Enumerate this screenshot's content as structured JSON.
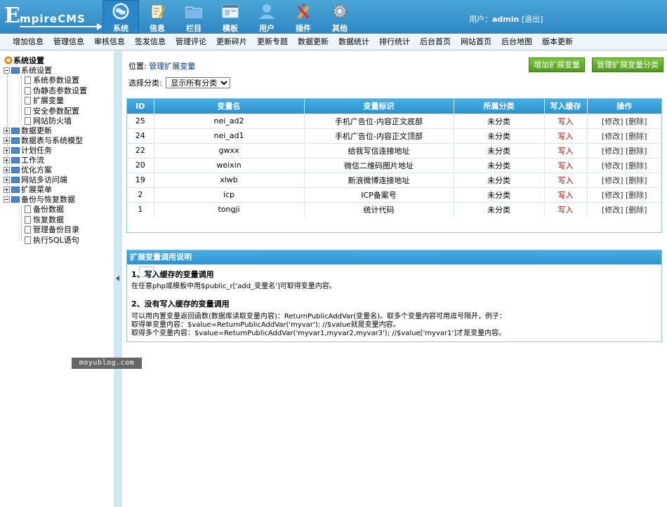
{
  "header": {
    "logo_first": "E",
    "logo_rest": "mpireCMS",
    "nav": [
      {
        "label": "系统",
        "icon": "globe-icon",
        "active": true
      },
      {
        "label": "信息",
        "icon": "edit-document-icon"
      },
      {
        "label": "栏目",
        "icon": "folder-icon"
      },
      {
        "label": "模板",
        "icon": "template-window-icon"
      },
      {
        "label": "用户",
        "icon": "user-icon"
      },
      {
        "label": "插件",
        "icon": "tools-icon"
      },
      {
        "label": "其他",
        "icon": "gear-icon"
      }
    ],
    "user_label": "用户：",
    "username": "admin",
    "logout": "[退出]"
  },
  "submenu": [
    "增加信息",
    "管理信息",
    "审核信息",
    "签发信息",
    "管理评论",
    "更新碎片",
    "更新专题",
    "数据更新",
    "数据统计",
    "排行统计",
    "后台首页",
    "网站首页",
    "后台地图",
    "版本更新"
  ],
  "sidebar": {
    "root": "系统设置",
    "items": [
      {
        "label": "系统设置",
        "type": "folder",
        "expanded": true
      },
      {
        "label": "系统参数设置",
        "type": "doc"
      },
      {
        "label": "伪静态参数设置",
        "type": "doc"
      },
      {
        "label": "扩展变量",
        "type": "doc"
      },
      {
        "label": "安全参数配置",
        "type": "doc"
      },
      {
        "label": "网站防火墙",
        "type": "doc"
      },
      {
        "label": "数据更新",
        "type": "folder"
      },
      {
        "label": "数据表与系统模型",
        "type": "folder"
      },
      {
        "label": "计划任务",
        "type": "folder"
      },
      {
        "label": "工作流",
        "type": "folder"
      },
      {
        "label": "优化方案",
        "type": "folder"
      },
      {
        "label": "网站多访问端",
        "type": "folder"
      },
      {
        "label": "扩展菜单",
        "type": "folder"
      },
      {
        "label": "备份与恢复数据",
        "type": "folder",
        "expanded": true
      },
      {
        "label": "备份数据",
        "type": "doc"
      },
      {
        "label": "恢复数据",
        "type": "doc"
      },
      {
        "label": "管理备份目录",
        "type": "doc"
      },
      {
        "label": "执行SQL语句",
        "type": "doc"
      }
    ]
  },
  "main": {
    "location_label": "位置: ",
    "location_link": "管理扩展变量",
    "btn_add": "增加扩展变量",
    "btn_manage_cat": "管理扩展变量分类",
    "filter_label": "选择分类:",
    "filter_value": "显示所有分类",
    "table": {
      "headers": [
        "ID",
        "变量名",
        "变量标识",
        "所属分类",
        "写入缓存",
        "操作"
      ],
      "rows": [
        {
          "id": "25",
          "name": "nei_ad2",
          "ident": "手机广告位-内容正文底部",
          "cat": "未分类",
          "cache": "写入",
          "edit": "[修改]",
          "del": "[删除]"
        },
        {
          "id": "24",
          "name": "nei_ad1",
          "ident": "手机广告位-内容正文顶部",
          "cat": "未分类",
          "cache": "写入",
          "edit": "[修改]",
          "del": "[删除]"
        },
        {
          "id": "22",
          "name": "gwxx",
          "ident": "给我写信连接地址",
          "cat": "未分类",
          "cache": "写入",
          "edit": "[修改]",
          "del": "[删除]"
        },
        {
          "id": "20",
          "name": "weixin",
          "ident": "微信二维码图片地址",
          "cat": "未分类",
          "cache": "写入",
          "edit": "[修改]",
          "del": "[删除]"
        },
        {
          "id": "19",
          "name": "xlwb",
          "ident": "新浪微博连接地址",
          "cat": "未分类",
          "cache": "写入",
          "edit": "[修改]",
          "del": "[删除]"
        },
        {
          "id": "2",
          "name": "icp",
          "ident": "ICP备案号",
          "cat": "未分类",
          "cache": "写入",
          "edit": "[修改]",
          "del": "[删除]"
        },
        {
          "id": "1",
          "name": "tongji",
          "ident": "统计代码",
          "cat": "未分类",
          "cache": "写入",
          "edit": "[修改]",
          "del": "[删除]"
        }
      ]
    },
    "info": {
      "title": "扩展变量调用说明",
      "h1": "1、写入缓存的变量调用",
      "p1": "在任意php或模板中用$public_r['add_变量名']可取得变量内容。",
      "h2": "2、没有写入缓存的变量调用",
      "p2": "可以用内置变量返回函数(数据库读取变量内容)：ReturnPublicAddVar(变量名)。取多个变量内容可用逗号隔开，例子：",
      "p3": "取得单变量内容：$value=ReturnPublicAddVar('myvar'); //$value就是变量内容。",
      "p4": "取得多个变量内容：$value=ReturnPublicAddVar('myvar1,myvar2,myvar3'); //$value['myvar1']才是变量内容。"
    }
  },
  "watermark": "moyublog.com",
  "colors": {
    "header_blue": "#2f86c2",
    "table_head_blue": "#2b92cf",
    "button_green": "#4f9a1e",
    "write_red": "#c00000"
  }
}
